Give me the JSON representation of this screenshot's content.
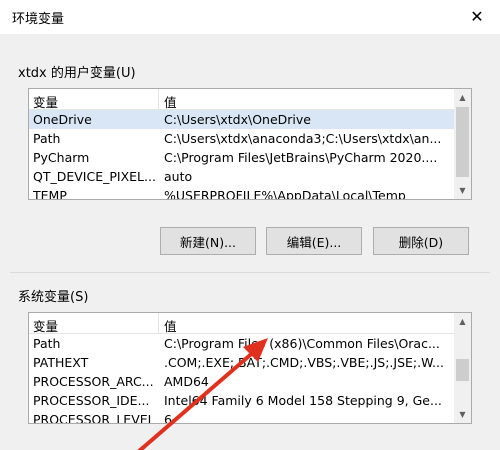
{
  "window": {
    "title": "环境变量",
    "close_glyph": "✕"
  },
  "user_vars": {
    "label": "xtdx 的用户变量(U)",
    "columns": [
      "变量",
      "值"
    ],
    "rows": [
      {
        "name": "OneDrive",
        "value": "C:\\Users\\xtdx\\OneDrive"
      },
      {
        "name": "Path",
        "value": "C:\\Users\\xtdx\\anaconda3;C:\\Users\\xtdx\\an..."
      },
      {
        "name": "PyCharm",
        "value": "C:\\Program Files\\JetBrains\\PyCharm 2020...."
      },
      {
        "name": "QT_DEVICE_PIXEL...",
        "value": "auto"
      },
      {
        "name": "TEMP",
        "value": "%USERPROFILE%\\AppData\\Local\\Temp"
      }
    ],
    "buttons": {
      "new": "新建(N)...",
      "edit": "编辑(E)...",
      "delete": "删除(D)"
    }
  },
  "system_vars": {
    "label": "系统变量(S)",
    "columns": [
      "变量",
      "值"
    ],
    "rows": [
      {
        "name": "Path",
        "value": "C:\\Program Files (x86)\\Common Files\\Orac..."
      },
      {
        "name": "PATHEXT",
        "value": ".COM;.EXE;.BAT;.CMD;.VBS;.VBE;.JS;.JSE;.W..."
      },
      {
        "name": "PROCESSOR_ARC...",
        "value": "AMD64"
      },
      {
        "name": "PROCESSOR_IDE...",
        "value": "Intel64 Family 6 Model 158 Stepping 9, Ge..."
      },
      {
        "name": "PROCESSOR_LEVEL",
        "value": "6"
      }
    ]
  },
  "colors": {
    "annotation_arrow": "#e0301e",
    "selection": "#d9e6f5"
  }
}
